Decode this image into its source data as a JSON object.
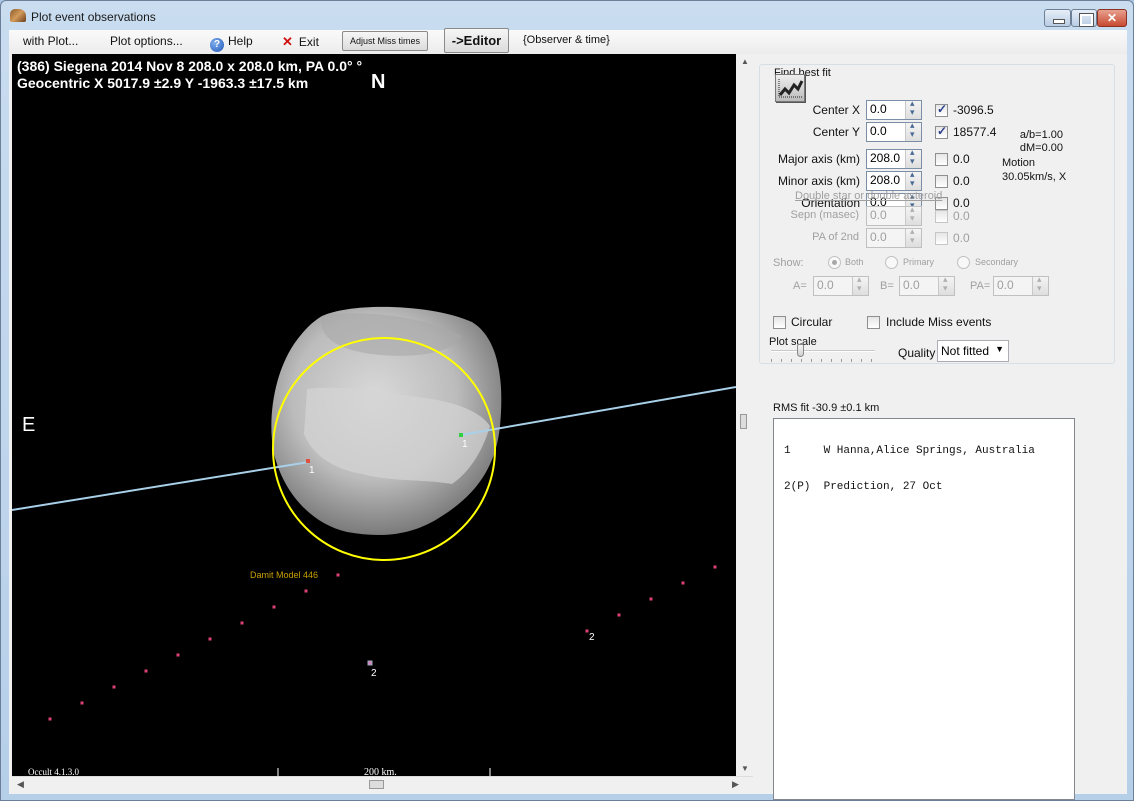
{
  "window": {
    "title": "Plot event observations"
  },
  "menu": {
    "with_plot": "with Plot...",
    "plot_options": "Plot options...",
    "help": "Help",
    "exit": "Exit",
    "adjust_miss_times": "Adjust Miss times",
    "editor": "->Editor",
    "observer_time": "{Observer & time}"
  },
  "plot": {
    "header_line1": "(386) Siegena  2014 Nov 8   208.0 x 208.0 km, PA 0.0° °",
    "header_line2": "Geocentric  X  5017.9 ±2.9  Y -1963.3 ±17.5 km",
    "north_label": "N",
    "east_label": "E",
    "model_label": "Damit Model 446",
    "version": "Occult 4.1.3.0",
    "scale_label": "200 km.",
    "chord_labels": [
      "1",
      "1",
      "2",
      "2"
    ],
    "colors": {
      "background": "#000000",
      "fit_ellipse": "#ffff00",
      "chord_line": "#a8d0e8",
      "disappear": "#e05040",
      "reappear": "#30d040",
      "prediction_dots": "#e0407a",
      "model_label": "#c8a000"
    }
  },
  "fit": {
    "title": "Find best fit",
    "fields": [
      {
        "label": "Center X",
        "value": "0.0",
        "checked": true,
        "result": "-3096.5"
      },
      {
        "label": "Center Y",
        "value": "0.0",
        "checked": true,
        "result": "18577.4"
      },
      {
        "label": "Major axis (km)",
        "value": "208.0",
        "checked": false,
        "result": "0.0"
      },
      {
        "label": "Minor axis (km)",
        "value": "208.0",
        "checked": false,
        "result": "0.0"
      },
      {
        "label": "Orientation",
        "value": "0.0",
        "checked": false,
        "result": "0.0"
      }
    ],
    "ab_ratio": "a/b=1.00",
    "dm": "dM=0.00",
    "motion_label": "Motion",
    "motion_value": "30.05km/s, X",
    "double_title": "Double star  or  double asteroid",
    "double_fields": [
      {
        "label": "Sepn (masec)",
        "value": "0.0",
        "result": "0.0"
      },
      {
        "label": "PA of 2nd",
        "value": "0.0",
        "result": "0.0"
      }
    ],
    "show_label": "Show:",
    "show_options": [
      "Both",
      "Primary",
      "Secondary"
    ],
    "show_selected": "Both",
    "a_label": "A=",
    "a_value": "0.0",
    "b_label": "B=",
    "b_value": "0.0",
    "pa_label": "PA=",
    "pa_value": "0.0"
  },
  "options": {
    "circular": "Circular",
    "include_miss": "Include Miss events",
    "plot_scale": "Plot scale",
    "plot_scale_position": 0.25,
    "quality_label": "Quality",
    "quality_value": "Not fitted",
    "rms_fit": "RMS fit -30.9 ±0.1 km"
  },
  "observations": [
    "1     W Hanna,Alice Springs, Australia",
    "2(P)  Prediction, 27 Oct"
  ]
}
